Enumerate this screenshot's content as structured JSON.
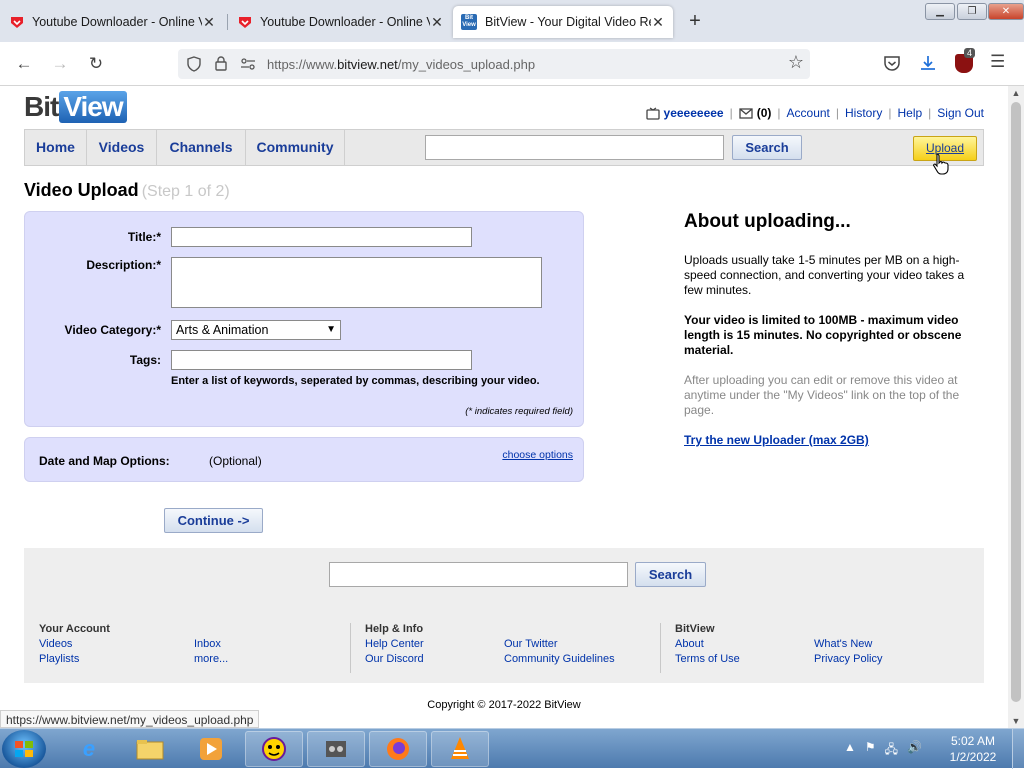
{
  "browser": {
    "tabs": [
      {
        "title": "Youtube Downloader - Online Vid",
        "active": false
      },
      {
        "title": "Youtube Downloader - Online Vid",
        "active": false
      },
      {
        "title": "BitView - Your Digital Video Rep",
        "active": true
      }
    ],
    "url_prefix": "https://www.",
    "url_host": "bitview.net",
    "url_path": "/my_videos_upload.php",
    "extension_badge": "4"
  },
  "site": {
    "logo_bit": "Bit",
    "logo_view": "View",
    "logo_favicon_top": "Bit",
    "logo_favicon_bottom": "View",
    "user": {
      "username": "yeeeeeeee",
      "inbox_count": "(0)",
      "links": [
        "Account",
        "History",
        "Help",
        "Sign Out"
      ]
    },
    "nav": [
      "Home",
      "Videos",
      "Channels",
      "Community"
    ],
    "search_label": "Search",
    "upload_label": "Upload"
  },
  "upload": {
    "title": "Video Upload",
    "step": "(Step 1 of 2)",
    "fields": {
      "title_label": "Title:*",
      "title_value": "",
      "description_label": "Description:*",
      "description_value": "",
      "category_label": "Video Category:*",
      "category_value": "Arts & Animation",
      "tags_label": "Tags:",
      "tags_value": ""
    },
    "tags_help": "Enter a list of keywords, seperated by commas, describing your video.",
    "required_note": "(* indicates required field)",
    "date_map": {
      "label": "Date and Map Options:",
      "optional": "(Optional)",
      "link": "choose options"
    },
    "continue_label": "Continue ->"
  },
  "about": {
    "title": "About uploading...",
    "p1": "Uploads usually take 1-5 minutes per MB on a high-speed connection, and converting your video takes a few minutes.",
    "p2": "Your video is limited to 100MB - maximum video length is 15 minutes. No copyrighted or obscene material.",
    "p3": "After uploading you can edit or remove this video at anytime under the \"My Videos\" link on the top of the page.",
    "link": "Try the new Uploader (max 2GB)"
  },
  "footer": {
    "search_label": "Search",
    "columns": [
      {
        "title": "Your Account",
        "left": [
          "Videos",
          "Playlists"
        ],
        "right": [
          "Inbox",
          "more..."
        ]
      },
      {
        "title": "Help & Info",
        "left": [
          "Help Center",
          "Our Discord"
        ],
        "right": [
          "Our Twitter",
          "Community Guidelines"
        ]
      },
      {
        "title": "BitView",
        "left": [
          "About",
          "Terms of Use"
        ],
        "right": [
          "What's New",
          "Privacy Policy"
        ]
      }
    ],
    "copyright": "Copyright © 2017-2022 BitView"
  },
  "status_bar_url": "https://www.bitview.net/my_videos_upload.php",
  "taskbar": {
    "time": "5:02 AM",
    "date": "1/2/2022"
  },
  "colors": {
    "form_bg": "#dfe0fd",
    "link": "#0033aa",
    "nav_text": "#1a3d99",
    "upload_btn": "#f5cf1a"
  }
}
